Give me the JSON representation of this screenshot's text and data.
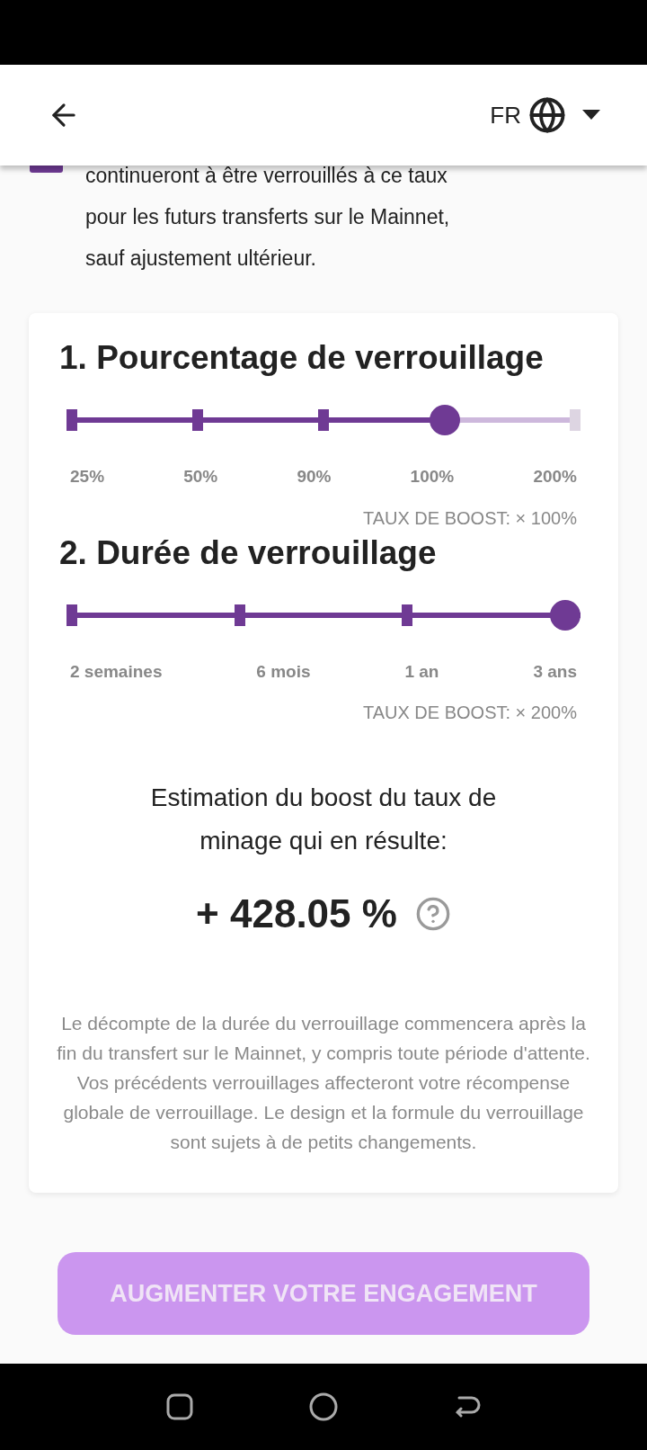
{
  "header": {
    "language": "FR"
  },
  "checkbox": {
    "checked": true
  },
  "intro_text": [
    "continueront à être verrouillés à ce taux",
    "pour les futurs transferts sur le Mainnet,",
    "sauf ajustement ultérieur."
  ],
  "sections": [
    {
      "title": "1. Pourcentage de verrouillage",
      "level": 0.75,
      "stops": [
        "25%",
        "50%",
        "90%",
        "100%",
        "200%"
      ],
      "boost": "TAUX DE BOOST: × 100%"
    },
    {
      "title": "2. Durée de verrouillage",
      "level": 1,
      "stops": [
        "2 semaines",
        "6 mois",
        "1 an",
        "3 ans"
      ],
      "boost": "TAUX DE BOOST: × 200%"
    }
  ],
  "estimate": {
    "label": "Estimation du boost du taux de minage qui en résulte:",
    "value": "+ 428.05 %"
  },
  "disclaimer": "Le décompte de la durée du verrouillage commencera après la fin du transfert sur le Mainnet, y compris toute période d'attente. Vos précédents verrouillages affecteront votre récompense globale de verrouillage. Le design et la formule du verrouillage sont sujets à de petits changements.",
  "button": {
    "label": "AUGMENTER VOTRE ENGAGEMENT",
    "disabled": true
  }
}
